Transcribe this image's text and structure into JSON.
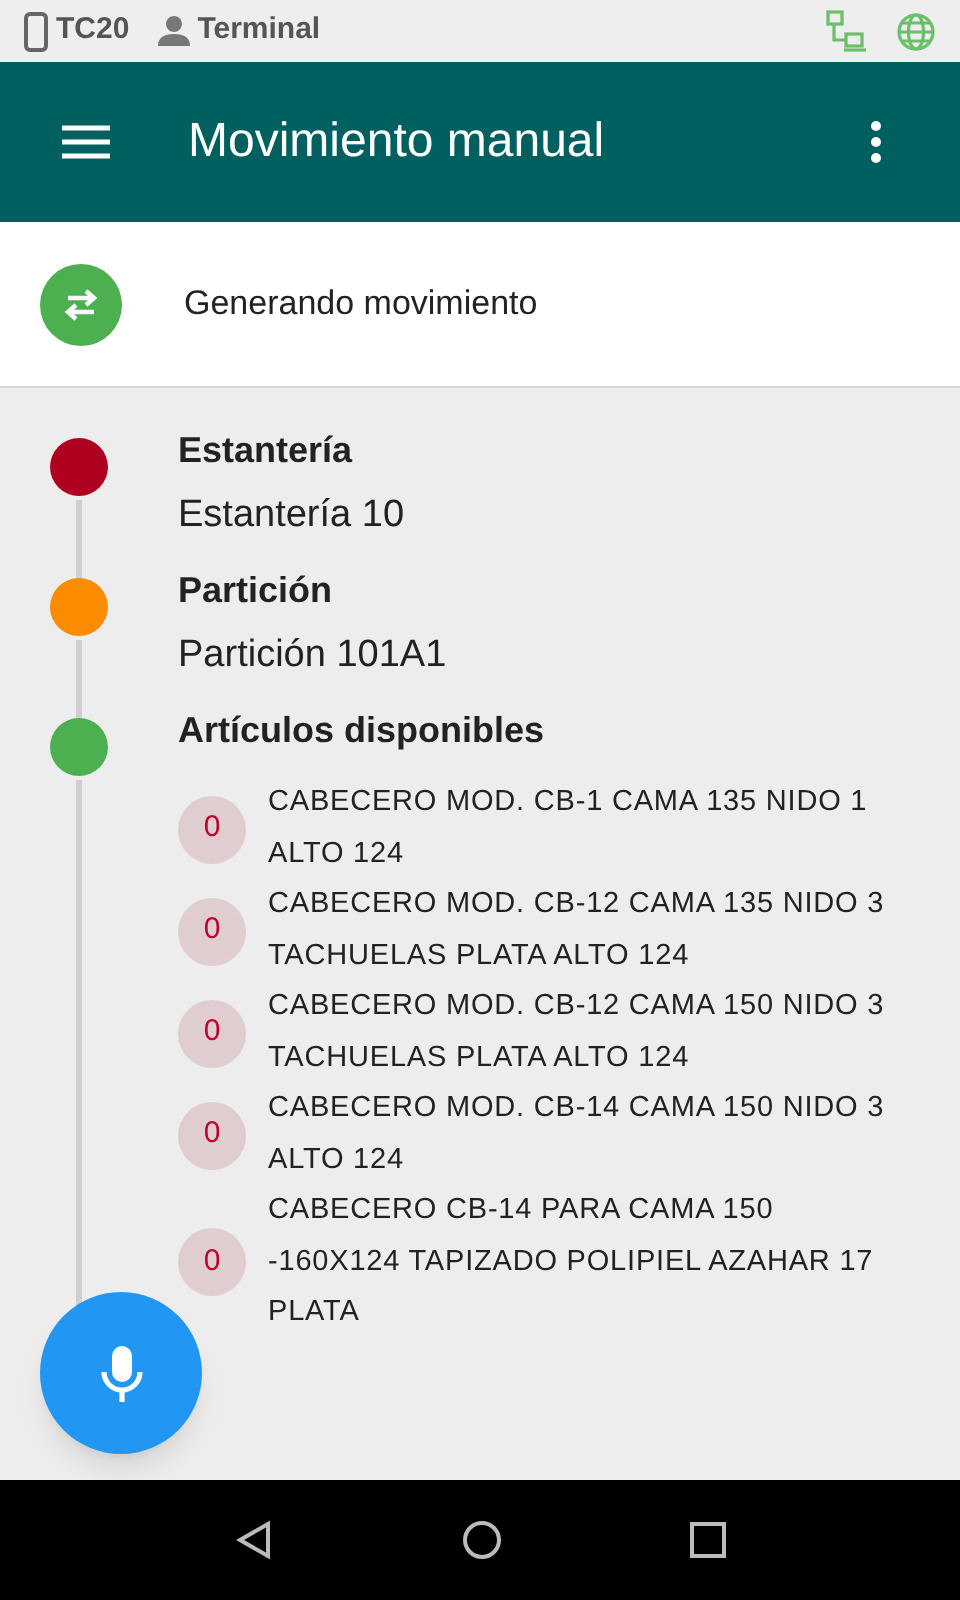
{
  "status_bar": {
    "device": "TC20",
    "user": "Terminal"
  },
  "app_bar": {
    "title": "Movimiento manual"
  },
  "header": {
    "text": "Generando movimiento"
  },
  "steps": [
    {
      "title": "Estantería",
      "color": "#b00020",
      "value": "Estantería 10"
    },
    {
      "title": "Partición",
      "color": "#fb8c00",
      "value": "Partición 101A1"
    },
    {
      "title": "Artículos disponibles",
      "color": "#4caf50",
      "items": [
        {
          "count": "0",
          "name": "CABECERO MOD. CB-1 CAMA 135 NIDO 1 ALTO 124"
        },
        {
          "count": "0",
          "name": "CABECERO MOD. CB-12 CAMA 135 NIDO 3 TACHUELAS PLATA ALTO 124"
        },
        {
          "count": "0",
          "name": "CABECERO MOD. CB-12 CAMA 150 NIDO 3 TACHUELAS PLATA ALTO 124"
        },
        {
          "count": "0",
          "name": "CABECERO MOD. CB-14 CAMA 150 NIDO 3 ALTO 124"
        },
        {
          "count": "0",
          "name": "CABECERO CB-14 PARA CAMA 150 -160X124 TAPIZADO POLIPIEL AZAHAR 17 PLATA"
        }
      ]
    }
  ]
}
